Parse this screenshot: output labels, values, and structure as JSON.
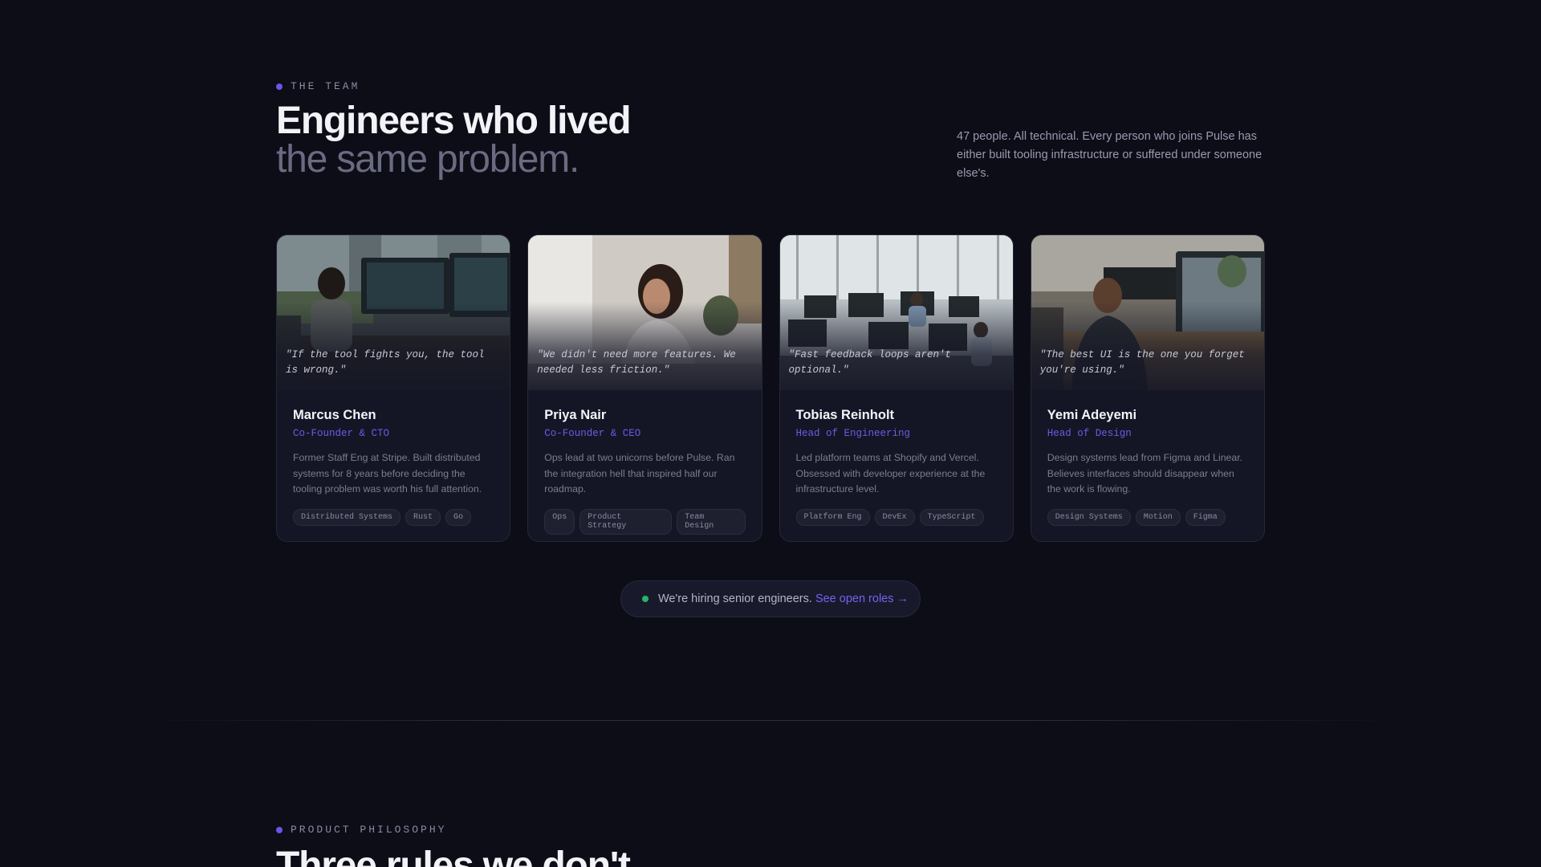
{
  "team": {
    "eyebrow": "THE TEAM",
    "headline_line1": "Engineers who lived",
    "headline_line2": "the same problem.",
    "intro": "47 people. All technical. Every person who joins Pulse has either built tooling infrastructure or suffered under someone else's.",
    "members": [
      {
        "quote": "\"If the tool fights you, the tool is wrong.\"",
        "name": "Marcus Chen",
        "role": "Co-Founder & CTO",
        "bio": "Former Staff Eng at Stripe. Built distributed systems for 8 years before deciding the tooling problem was worth his full attention.",
        "tags": [
          "Distributed Systems",
          "Rust",
          "Go"
        ]
      },
      {
        "quote": "\"We didn't need more features. We needed less friction.\"",
        "name": "Priya Nair",
        "role": "Co-Founder & CEO",
        "bio": "Ops lead at two unicorns before Pulse. Ran the integration hell that inspired half our roadmap.",
        "tags": [
          "Ops",
          "Product Strategy",
          "Team Design"
        ]
      },
      {
        "quote": "\"Fast feedback loops aren't optional.\"",
        "name": "Tobias Reinholt",
        "role": "Head of Engineering",
        "bio": "Led platform teams at Shopify and Vercel. Obsessed with developer experience at the infrastructure level.",
        "tags": [
          "Platform Eng",
          "DevEx",
          "TypeScript"
        ]
      },
      {
        "quote": "\"The best UI is the one you forget you're using.\"",
        "name": "Yemi Adeyemi",
        "role": "Head of Design",
        "bio": "Design systems lead from Figma and Linear. Believes interfaces should disappear when the work is flowing.",
        "tags": [
          "Design Systems",
          "Motion",
          "Figma"
        ]
      }
    ]
  },
  "hiring": {
    "text": "We're hiring senior engineers.",
    "link": "See open roles →"
  },
  "philosophy": {
    "eyebrow": "PRODUCT PHILOSOPHY",
    "headline": "Three rules we don't"
  },
  "colors": {
    "background": "#0c0d16",
    "accent": "#6f5ae6",
    "card": "#141625",
    "status_green": "#27b36b"
  }
}
